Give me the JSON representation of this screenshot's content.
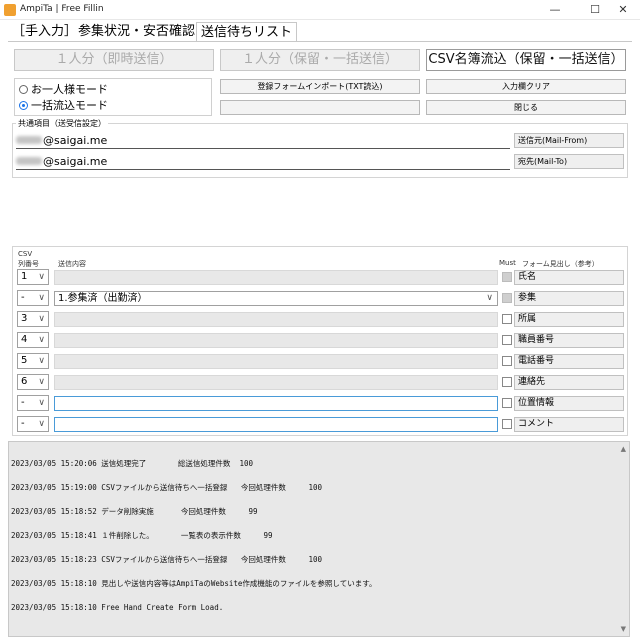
{
  "window": {
    "title": "AmpiTa | Free Fillin",
    "minimize": "—",
    "maximize": "☐",
    "close": "✕"
  },
  "tabs": [
    {
      "label": "［手入力］"
    },
    {
      "label": "参集状況・安否確認"
    },
    {
      "label": "送信待ちリスト"
    }
  ],
  "actions": {
    "send_single_now": "１人分（即時送信）",
    "send_single_hold": "１人分（保留・一括送信）",
    "csv_import": "CSV名簿流込（保留・一括送信）",
    "form_import": "登録フォームインポート(TXT読込)",
    "clear_inputs": "入力欄クリア",
    "blank": "",
    "close": "閉じる"
  },
  "mode": {
    "single": "お一人様モード",
    "batch": "一括流込モード",
    "selected": "batch"
  },
  "common": {
    "group_label": "共通項目（送受信設定）",
    "from_value": "@saigai.me",
    "to_value": "@saigai.me",
    "from_button": "送信元(Mail-From)",
    "to_button": "宛先(Mail-To)"
  },
  "table": {
    "csv_label": "CSV",
    "col_number": "列番号",
    "col_content": "送信内容",
    "col_must": "Must",
    "col_form": "フォーム見出し（参考）",
    "rows": [
      {
        "num": "1",
        "content": "",
        "field": "氏名"
      },
      {
        "num": "-",
        "content": "1.参集済（出勤済）",
        "field": "参集"
      },
      {
        "num": "3",
        "content": "",
        "field": "所属"
      },
      {
        "num": "4",
        "content": "",
        "field": "職員番号"
      },
      {
        "num": "5",
        "content": "",
        "field": "電話番号"
      },
      {
        "num": "6",
        "content": "",
        "field": "連絡先"
      },
      {
        "num": "-",
        "content": "",
        "field": "位置情報"
      },
      {
        "num": "-",
        "content": "",
        "field": "コメント"
      }
    ]
  },
  "log": {
    "lines": [
      "2023/03/05 15:20:06 送信処理完了       総送信処理件数  100",
      "2023/03/05 15:19:00 CSVファイルから送信待ちへ一括登録   今回処理件数     100",
      "2023/03/05 15:18:52 データ削除実施      今回処理件数     99",
      "2023/03/05 15:18:41 １件削除した。      一覧表の表示件数     99",
      "2023/03/05 15:18:23 CSVファイルから送信待ちへ一括登録   今回処理件数     100",
      "2023/03/05 15:18:10 見出しや送信内容等はAmpiTaのWebsite作成機能のファイルを参照しています。",
      "2023/03/05 15:18:10 Free Hand Create Form Load."
    ]
  },
  "icons": {
    "dropdown": "∨",
    "scroll_up": "▲",
    "scroll_down": "▼"
  }
}
